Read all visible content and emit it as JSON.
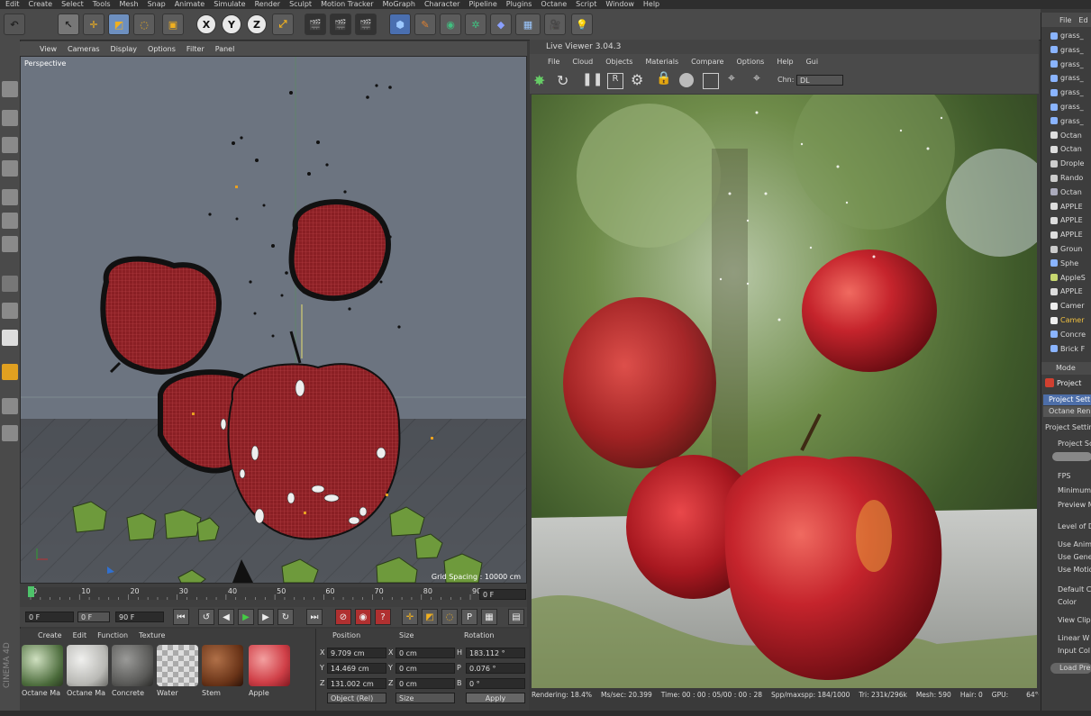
{
  "menu": [
    "Edit",
    "Create",
    "Select",
    "Tools",
    "Mesh",
    "Snap",
    "Animate",
    "Simulate",
    "Render",
    "Sculpt",
    "Motion Tracker",
    "MoGraph",
    "Character",
    "Pipeline",
    "Plugins",
    "Octane",
    "Script",
    "Window",
    "Help"
  ],
  "toolbar": {
    "axis_x": "X",
    "axis_y": "Y",
    "axis_z": "Z"
  },
  "viewport": {
    "menu": [
      "View",
      "Cameras",
      "Display",
      "Options",
      "Filter",
      "Panel"
    ],
    "label": "Perspective",
    "grid_spacing": "Grid Spacing : 10000 cm"
  },
  "timeline": {
    "ticks": [
      "0",
      "10",
      "20",
      "30",
      "40",
      "50",
      "60",
      "70",
      "80",
      "90"
    ],
    "frame_field": "0 F"
  },
  "transport": {
    "start": "0 F",
    "current": "0 F",
    "end": "90 F",
    "end2": "90 F"
  },
  "materials": {
    "menu": [
      "Create",
      "Edit",
      "Function",
      "Texture"
    ],
    "items": [
      "Octane Ma",
      "Octane Ma",
      "Concrete",
      "Water",
      "Stem",
      "Apple"
    ]
  },
  "coords": {
    "headers": [
      "Position",
      "Size",
      "Rotation"
    ],
    "rows": [
      {
        "axis": "X",
        "pos": "9.709 cm",
        "size_axis": "X",
        "size": "0 cm",
        "rot_axis": "H",
        "rot": "183.112 °"
      },
      {
        "axis": "Y",
        "pos": "14.469 cm",
        "size_axis": "Y",
        "size": "0 cm",
        "rot_axis": "P",
        "rot": "0.076 °"
      },
      {
        "axis": "Z",
        "pos": "131.002 cm",
        "size_axis": "Z",
        "size": "0 cm",
        "rot_axis": "B",
        "rot": "0 °"
      }
    ],
    "mode_select": "Object (Rel)",
    "size_select": "Size",
    "apply": "Apply"
  },
  "live_viewer": {
    "title": "Live Viewer 3.04.3",
    "menu": [
      "File",
      "Cloud",
      "Objects",
      "Materials",
      "Compare",
      "Options",
      "Help",
      "Gui"
    ],
    "chn_label": "Chn:",
    "chn_value": "DL"
  },
  "status": {
    "rendering": "Rendering: 18.4%",
    "ms": "Ms/sec: 20.399",
    "time": "Time: 00 : 00 : 05/00 : 00 : 28",
    "spp": "Spp/maxspp: 184/1000",
    "tri": "Tri: 231k/296k",
    "mesh": "Mesh: 590",
    "hair": "Hair: 0",
    "gpu": "GPU:",
    "temp": "64°C"
  },
  "objects": {
    "file_menu": [
      "File",
      "Ed"
    ],
    "items": [
      "grass_",
      "grass_",
      "grass_",
      "grass_",
      "grass_",
      "grass_",
      "grass_",
      "Octan",
      "Octan",
      "Drople",
      "Rando",
      "Octan",
      "APPLE",
      "APPLE",
      "APPLE",
      "Groun",
      "Sphe",
      "AppleS",
      "APPLE",
      "Camer",
      "Camer",
      "Concre",
      "Brick F"
    ]
  },
  "attributes": {
    "mode": "Mode",
    "project": "Project",
    "tabs": [
      "Project Setti",
      "Octane Ren"
    ],
    "section": "Project Settin",
    "rows": [
      "Project Sc",
      "FPS",
      "Minimum",
      "Preview M",
      "Level of D",
      "Use Anim",
      "Use Gene",
      "Use Motio",
      "Default C",
      "Color",
      "View Clip",
      "Linear W",
      "Input Col"
    ],
    "load_preset": "Load Pre"
  },
  "colors": {
    "accent": "#6d8fbf",
    "apple_red": "#b3262b",
    "grass": "#5d7f3a"
  }
}
